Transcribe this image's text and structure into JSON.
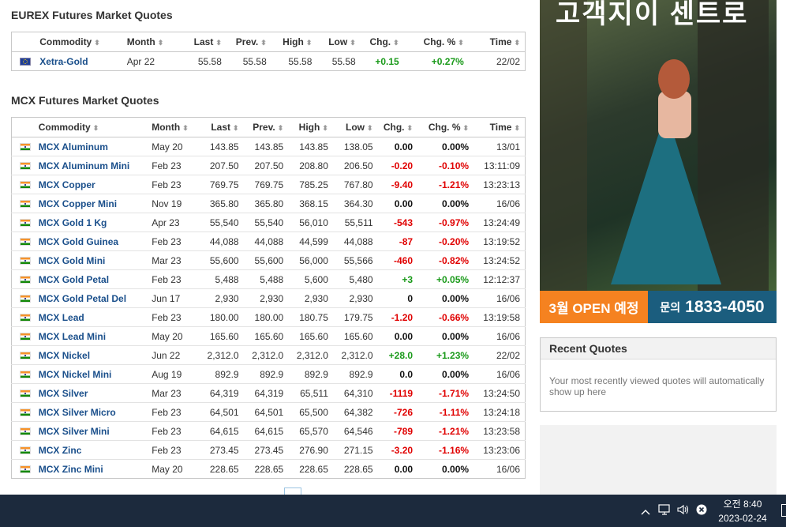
{
  "eurex": {
    "title": "EUREX Futures Market Quotes",
    "headers": [
      "Commodity",
      "Month",
      "Last",
      "Prev.",
      "High",
      "Low",
      "Chg.",
      "Chg. %",
      "Time"
    ],
    "rows": [
      {
        "name": "Xetra-Gold",
        "month": "Apr 22",
        "last": "55.58",
        "prev": "55.58",
        "high": "55.58",
        "low": "55.58",
        "chg": "+0.15",
        "pct": "+0.27%",
        "time": "22/02",
        "dir": "up",
        "flag": "eu"
      }
    ]
  },
  "mcx": {
    "title": "MCX Futures Market Quotes",
    "headers": [
      "Commodity",
      "Month",
      "Last",
      "Prev.",
      "High",
      "Low",
      "Chg.",
      "Chg. %",
      "Time"
    ],
    "rows": [
      {
        "name": "MCX Aluminum",
        "month": "May 20",
        "last": "143.85",
        "prev": "143.85",
        "high": "143.85",
        "low": "138.05",
        "chg": "0.00",
        "pct": "0.00%",
        "time": "13/01",
        "dir": "flat",
        "flag": "in"
      },
      {
        "name": "MCX Aluminum Mini",
        "month": "Feb 23",
        "last": "207.50",
        "prev": "207.50",
        "high": "208.80",
        "low": "206.50",
        "chg": "-0.20",
        "pct": "-0.10%",
        "time": "13:11:09",
        "dir": "down",
        "flag": "in"
      },
      {
        "name": "MCX Copper",
        "month": "Feb 23",
        "last": "769.75",
        "prev": "769.75",
        "high": "785.25",
        "low": "767.80",
        "chg": "-9.40",
        "pct": "-1.21%",
        "time": "13:23:13",
        "dir": "down",
        "flag": "in"
      },
      {
        "name": "MCX Copper Mini",
        "month": "Nov 19",
        "last": "365.80",
        "prev": "365.80",
        "high": "368.15",
        "low": "364.30",
        "chg": "0.00",
        "pct": "0.00%",
        "time": "16/06",
        "dir": "flat",
        "flag": "in"
      },
      {
        "name": "MCX Gold 1 Kg",
        "month": "Apr 23",
        "last": "55,540",
        "prev": "55,540",
        "high": "56,010",
        "low": "55,511",
        "chg": "-543",
        "pct": "-0.97%",
        "time": "13:24:49",
        "dir": "down",
        "flag": "in"
      },
      {
        "name": "MCX Gold Guinea",
        "month": "Feb 23",
        "last": "44,088",
        "prev": "44,088",
        "high": "44,599",
        "low": "44,088",
        "chg": "-87",
        "pct": "-0.20%",
        "time": "13:19:52",
        "dir": "down",
        "flag": "in"
      },
      {
        "name": "MCX Gold Mini",
        "month": "Mar 23",
        "last": "55,600",
        "prev": "55,600",
        "high": "56,000",
        "low": "55,566",
        "chg": "-460",
        "pct": "-0.82%",
        "time": "13:24:52",
        "dir": "down",
        "flag": "in"
      },
      {
        "name": "MCX Gold Petal",
        "month": "Feb 23",
        "last": "5,488",
        "prev": "5,488",
        "high": "5,600",
        "low": "5,480",
        "chg": "+3",
        "pct": "+0.05%",
        "time": "12:12:37",
        "dir": "up",
        "flag": "in"
      },
      {
        "name": "MCX Gold Petal Del",
        "month": "Jun 17",
        "last": "2,930",
        "prev": "2,930",
        "high": "2,930",
        "low": "2,930",
        "chg": "0",
        "pct": "0.00%",
        "time": "16/06",
        "dir": "flat",
        "flag": "in"
      },
      {
        "name": "MCX Lead",
        "month": "Feb 23",
        "last": "180.00",
        "prev": "180.00",
        "high": "180.75",
        "low": "179.75",
        "chg": "-1.20",
        "pct": "-0.66%",
        "time": "13:19:58",
        "dir": "down",
        "flag": "in"
      },
      {
        "name": "MCX Lead Mini",
        "month": "May 20",
        "last": "165.60",
        "prev": "165.60",
        "high": "165.60",
        "low": "165.60",
        "chg": "0.00",
        "pct": "0.00%",
        "time": "16/06",
        "dir": "flat",
        "flag": "in"
      },
      {
        "name": "MCX Nickel",
        "month": "Jun 22",
        "last": "2,312.0",
        "prev": "2,312.0",
        "high": "2,312.0",
        "low": "2,312.0",
        "chg": "+28.0",
        "pct": "+1.23%",
        "time": "22/02",
        "dir": "up",
        "flag": "in"
      },
      {
        "name": "MCX Nickel Mini",
        "month": "Aug 19",
        "last": "892.9",
        "prev": "892.9",
        "high": "892.9",
        "low": "892.9",
        "chg": "0.0",
        "pct": "0.00%",
        "time": "16/06",
        "dir": "flat",
        "flag": "in"
      },
      {
        "name": "MCX Silver",
        "month": "Mar 23",
        "last": "64,319",
        "prev": "64,319",
        "high": "65,511",
        "low": "64,310",
        "chg": "-1119",
        "pct": "-1.71%",
        "time": "13:24:50",
        "dir": "down",
        "flag": "in"
      },
      {
        "name": "MCX Silver Micro",
        "month": "Feb 23",
        "last": "64,501",
        "prev": "64,501",
        "high": "65,500",
        "low": "64,382",
        "chg": "-726",
        "pct": "-1.11%",
        "time": "13:24:18",
        "dir": "down",
        "flag": "in"
      },
      {
        "name": "MCX Silver Mini",
        "month": "Feb 23",
        "last": "64,615",
        "prev": "64,615",
        "high": "65,570",
        "low": "64,546",
        "chg": "-789",
        "pct": "-1.21%",
        "time": "13:23:58",
        "dir": "down",
        "flag": "in"
      },
      {
        "name": "MCX Zinc",
        "month": "Feb 23",
        "last": "273.45",
        "prev": "273.45",
        "high": "276.90",
        "low": "271.15",
        "chg": "-3.20",
        "pct": "-1.16%",
        "time": "13:23:06",
        "dir": "down",
        "flag": "in"
      },
      {
        "name": "MCX Zinc Mini",
        "month": "May 20",
        "last": "228.65",
        "prev": "228.65",
        "high": "228.65",
        "low": "228.65",
        "chg": "0.00",
        "pct": "0.00%",
        "time": "16/06",
        "dir": "flat",
        "flag": "in"
      }
    ]
  },
  "ad": {
    "headline": "고객지이 센트로",
    "open_label": "3월 OPEN 예정",
    "phone_label": "문의",
    "phone_number": "1833-4050"
  },
  "recent": {
    "title": "Recent Quotes",
    "message": "Your most recently viewed quotes will automatically show up here"
  },
  "taskbar": {
    "time": "오전 8:40",
    "date": "2023-02-24"
  },
  "colors": {
    "up": "#1a9a1a",
    "down": "#e00000",
    "link": "#1a4f8b",
    "taskbar": "#1c2a3d"
  }
}
